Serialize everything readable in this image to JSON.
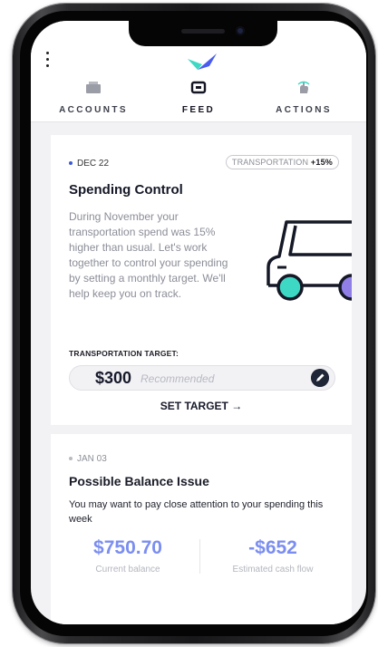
{
  "nav": {
    "tabs": [
      {
        "label": "ACCOUNTS",
        "icon": "wallet-icon",
        "active": false
      },
      {
        "label": "FEED",
        "icon": "feed-icon",
        "active": true
      },
      {
        "label": "ACTIONS",
        "icon": "action-icon",
        "active": false
      }
    ]
  },
  "spending_card": {
    "date": "DEC 22",
    "tag_category": "TRANSPORTATION",
    "tag_change": "+15%",
    "title": "Spending Control",
    "body": "During November your transportation spend was 15% higher than usual. Let's work together to control your spending by setting a monthly target. We'll help keep you on track.",
    "target_label": "TRANSPORTATION TARGET:",
    "target_value": "$300",
    "target_placeholder": "Recommended",
    "set_target_label": "SET TARGET →"
  },
  "balance_card": {
    "date": "JAN 03",
    "title": "Possible Balance Issue",
    "body": "You may want to pay close attention to your spending this week",
    "current_balance_value": "$750.70",
    "current_balance_label": "Current balance",
    "cash_flow_value": "-$652",
    "cash_flow_label": "Estimated cash flow"
  },
  "colors": {
    "accent": "#7b8ef0",
    "dark": "#151826",
    "logo_teal": "#3dd9c5",
    "logo_blue": "#4a5cf0"
  }
}
